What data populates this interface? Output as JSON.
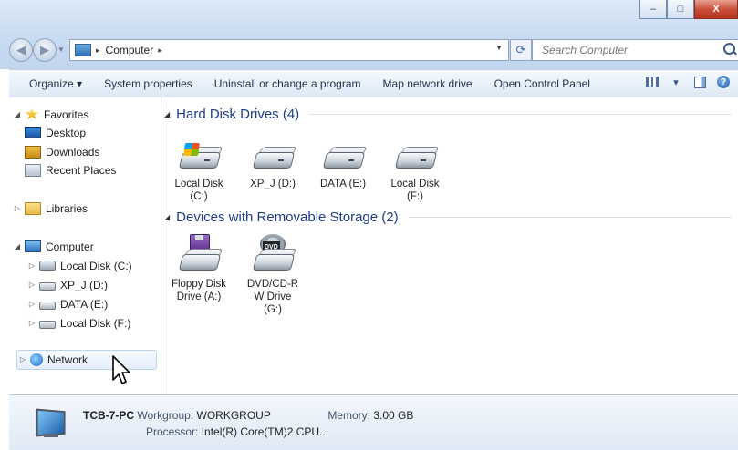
{
  "window": {
    "min_label": "–",
    "max_label": "□",
    "close_label": "X"
  },
  "address": {
    "crumbs": [
      "Computer"
    ],
    "separator": "▸"
  },
  "search": {
    "placeholder": "Search Computer"
  },
  "toolbar": {
    "organize": "Organize ▾",
    "system_properties": "System properties",
    "uninstall": "Uninstall or change a program",
    "map_drive": "Map network drive",
    "control_panel": "Open Control Panel",
    "views_drop": "▾",
    "help": "?"
  },
  "sidebar": {
    "favorites": "Favorites",
    "desktop": "Desktop",
    "downloads": "Downloads",
    "recent": "Recent Places",
    "libraries": "Libraries",
    "computer": "Computer",
    "drives": [
      "Local Disk (C:)",
      "XP_J (D:)",
      "DATA (E:)",
      "Local Disk (F:)"
    ],
    "network": "Network"
  },
  "content": {
    "hdd_group": "Hard Disk Drives (4)",
    "removable_group": "Devices with Removable Storage (2)",
    "hdd": [
      {
        "line1": "Local Disk",
        "line2": "(C:)"
      },
      {
        "line1": "XP_J (D:)",
        "line2": ""
      },
      {
        "line1": "DATA (E:)",
        "line2": ""
      },
      {
        "line1": "Local Disk",
        "line2": "(F:)"
      }
    ],
    "removable": [
      {
        "line1": "Floppy Disk",
        "line2": "Drive (A:)",
        "line3": ""
      },
      {
        "line1": "DVD/CD-R",
        "line2": "W Drive",
        "line3": "(G:)"
      }
    ],
    "dvd_badge": "DVD"
  },
  "details": {
    "pc_name": "TCB-7-PC",
    "workgroup_label": "Workgroup:",
    "workgroup_value": "WORKGROUP",
    "memory_label": "Memory:",
    "memory_value": "3.00 GB",
    "processor_label": "Processor:",
    "processor_value": "Intel(R) Core(TM)2 CPU..."
  },
  "icons": {
    "expand_open": "◢",
    "expand_closed": "▷",
    "group_toggle": "◢"
  },
  "colors": {
    "group_header": "#1e3c8a",
    "selection": "#e4eefb"
  }
}
